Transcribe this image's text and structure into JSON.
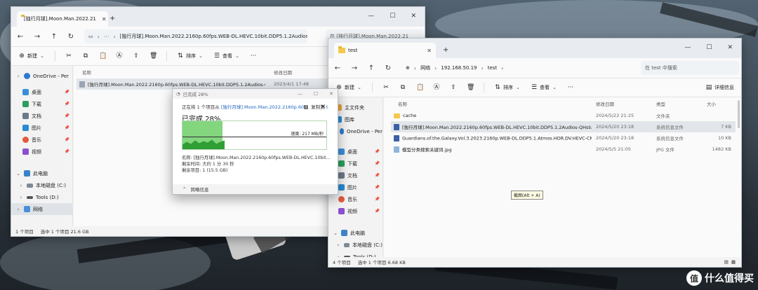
{
  "colors": {
    "accent": "#1d64c2",
    "progress_fill": "#83d57e",
    "folder": "#f4c84d",
    "selection": "#e2e6ea"
  },
  "window_left": {
    "tab_title": "[独行月球].Moon.Man.2022.21",
    "address_crumb": "[独行月球].Moon.Man.2022.2160p.60fps.WEB-DL.HEVC.10bit.DDP5.1.2Audios-QHstu",
    "search_placeholder": "在 [独行月球].Moon.Man.2022.21",
    "toolbar": {
      "new_label": "新建",
      "sort_label": "排序",
      "view_label": "查看"
    },
    "sidebar": [
      {
        "label": "OneDrive - Per",
        "icon": "cloud-icon"
      },
      {
        "label": "桌面",
        "icon": "desktop-icon",
        "pinned": true
      },
      {
        "label": "下载",
        "icon": "download-icon",
        "pinned": true
      },
      {
        "label": "文档",
        "icon": "documents-icon",
        "pinned": true
      },
      {
        "label": "图片",
        "icon": "pictures-icon",
        "pinned": true
      },
      {
        "label": "音乐",
        "icon": "music-icon",
        "pinned": true
      },
      {
        "label": "视频",
        "icon": "videos-icon",
        "pinned": true
      },
      {
        "label": "此电脑",
        "icon": "computer-icon"
      },
      {
        "label": "本地磁盘 (C:)",
        "icon": "drive-icon"
      },
      {
        "label": "Tools (D:)",
        "icon": "drive-icon"
      },
      {
        "label": "网络",
        "icon": "network-icon"
      }
    ],
    "columns": {
      "name": "名称",
      "modified": "修改日期"
    },
    "files": [
      {
        "name": "[独行月球].Moon.Man.2022.2160p.60fps.WEB-DL.HEVC.10bit.DDP5.1.2Audios-QHstud...",
        "modified": "2023/4/1 17:48"
      }
    ],
    "status": {
      "count": "1 个项目",
      "selected": "选中 1 个项目  21.6 GB"
    }
  },
  "window_right": {
    "tab_title": "test",
    "crumbs": [
      "网络",
      "192.168.50.19",
      "test"
    ],
    "search_placeholder": "在 test 中搜索",
    "toolbar": {
      "new_label": "新建",
      "sort_label": "排序",
      "view_label": "查看",
      "details_label": "详细信息"
    },
    "sidebar": [
      {
        "label": "主文件夹",
        "icon": "home-icon"
      },
      {
        "label": "图库",
        "icon": "gallery-icon"
      },
      {
        "label": "OneDrive - Per",
        "icon": "cloud-icon"
      },
      {
        "label": "桌面",
        "icon": "desktop-icon",
        "pinned": true
      },
      {
        "label": "下载",
        "icon": "download-icon",
        "pinned": true
      },
      {
        "label": "文档",
        "icon": "documents-icon",
        "pinned": true
      },
      {
        "label": "图片",
        "icon": "pictures-icon",
        "pinned": true
      },
      {
        "label": "音乐",
        "icon": "music-icon",
        "pinned": true
      },
      {
        "label": "视频",
        "icon": "videos-icon",
        "pinned": true
      },
      {
        "label": "此电脑",
        "icon": "computer-icon"
      },
      {
        "label": "本地磁盘 (C:)",
        "icon": "drive-icon"
      },
      {
        "label": "Tools (D:)",
        "icon": "drive-icon"
      }
    ],
    "columns": {
      "name": "名称",
      "modified": "修改日期",
      "type": "类型",
      "size": "大小"
    },
    "files": [
      {
        "name": "cache",
        "modified": "2024/5/22 21:25",
        "type": "文件夹",
        "size": "",
        "icon": "folder-icon"
      },
      {
        "name": "[独行月球].Moon.Man.2022.2160p.60fps.WEB-DL.HEVC.10bit.DDP5.1.2Audios-QHstudio...",
        "modified": "2024/5/20 23:18",
        "type": "系统信息文件",
        "size": "7 KB",
        "icon": "sysinfo-icon"
      },
      {
        "name": "Guardians.of.the.Galaxy.Vol.3.2023.2160p.WEB-DL.DDP5.1.Atmos.HDR.DV.HEVC-CMRG...",
        "modified": "2024/5/20 23:18",
        "type": "系统信息文件",
        "size": "10 KB",
        "icon": "sysinfo-icon"
      },
      {
        "name": "模型分类搜索关键词.jpg",
        "modified": "2024/5/5 21:05",
        "type": "JPG 文件",
        "size": "1482 KB",
        "icon": "image-file-icon"
      }
    ],
    "status": {
      "count": "4 个项目",
      "selected": "选中 1 个项目  6.68 KB"
    }
  },
  "copy_dialog": {
    "title": "已完成 28%",
    "line1_prefix": "正在将 1 个项目从 ",
    "line1_source": "[独行月球].Moon.Man.2022.2160p.60f...",
    "line1_mid": " 复制到 ",
    "line1_dest": "test",
    "heading": "已完成 28%",
    "progress_fraction": 0.28,
    "speed": "速度: 217 MB/秒",
    "name_line": "名称: [独行月球].Moon.Man.2022.2160p.60fps.WEB-DL.HEVC.10bit...",
    "remaining_time": "剩余时间: 大约 1 分 30 秒",
    "remaining_items": "剩余项目: 1 (15.5 GB)",
    "less_details": "简略信息"
  },
  "tooltip": "截图(Alt + A)",
  "watermark": "什么值得买"
}
